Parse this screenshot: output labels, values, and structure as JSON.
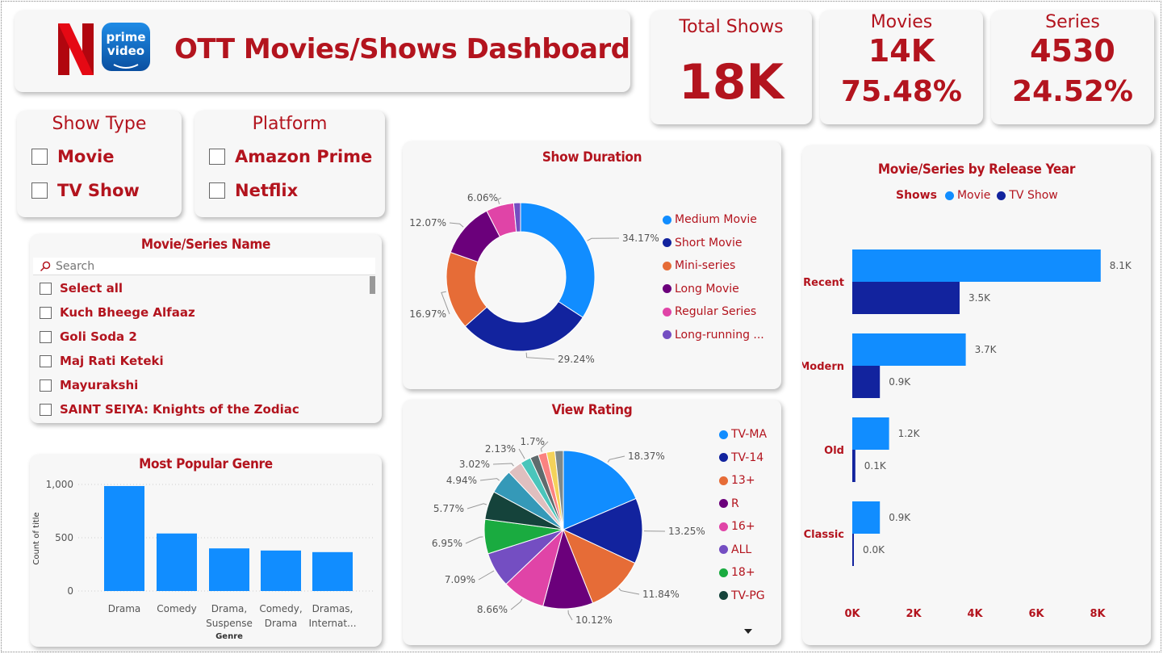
{
  "header": {
    "title": "OTT Movies/Shows Dashboard",
    "prime_logo_line1": "prime",
    "prime_logo_line2": "video"
  },
  "kpis": {
    "total": {
      "label": "Total Shows",
      "value": "18K"
    },
    "movies": {
      "label": "Movies",
      "value": "14K",
      "pct": "75.48%"
    },
    "series": {
      "label": "Series",
      "value": "4530",
      "pct": "24.52%"
    }
  },
  "show_type_slicer": {
    "title": "Show Type",
    "options": [
      "Movie",
      "TV Show"
    ]
  },
  "platform_slicer": {
    "title": "Platform",
    "options": [
      "Amazon Prime",
      "Netflix"
    ]
  },
  "name_slicer": {
    "title": "Movie/Series Name",
    "search_placeholder": "Search",
    "items": [
      "Select all",
      "Kuch Bheege Alfaaz",
      "Goli Soda 2",
      "Maj Rati Keteki",
      "Mayurakshi",
      "SAINT SEIYA: Knights of the Zodiac"
    ]
  },
  "colors": {
    "brand_red": "#b3141e",
    "movie": "#118dff",
    "tv_show": "#12239e"
  },
  "chart_data": [
    {
      "id": "show_duration",
      "type": "donut",
      "title": "Show Duration",
      "slices": [
        {
          "name": "Medium Movie",
          "value": 34.17,
          "label": "34.17%",
          "color": "#118dff"
        },
        {
          "name": "Short Movie",
          "value": 29.24,
          "label": "29.24%",
          "color": "#12239e"
        },
        {
          "name": "Mini-series",
          "value": 16.97,
          "label": "16.97%",
          "color": "#e66c37"
        },
        {
          "name": "Long Movie",
          "value": 12.07,
          "label": "12.07%",
          "color": "#6b007b"
        },
        {
          "name": "Regular Series",
          "value": 6.06,
          "label": "6.06%",
          "color": "#e044a7"
        },
        {
          "name": "Long-running ...",
          "value": 1.49,
          "label": "",
          "color": "#744ec2"
        }
      ]
    },
    {
      "id": "view_rating",
      "type": "pie",
      "title": "View Rating",
      "slices": [
        {
          "name": "TV-MA",
          "value": 18.37,
          "label": "18.37%",
          "color": "#118dff"
        },
        {
          "name": "TV-14",
          "value": 13.25,
          "label": "13.25%",
          "color": "#12239e"
        },
        {
          "name": "13+",
          "value": 11.84,
          "label": "11.84%",
          "color": "#e66c37"
        },
        {
          "name": "R",
          "value": 10.12,
          "label": "10.12%",
          "color": "#6b007b"
        },
        {
          "name": "16+",
          "value": 8.66,
          "label": "8.66%",
          "color": "#e044a7"
        },
        {
          "name": "ALL",
          "value": 7.09,
          "label": "7.09%",
          "color": "#744ec2"
        },
        {
          "name": "18+",
          "value": 6.95,
          "label": "6.95%",
          "color": "#1aab40"
        },
        {
          "name": "TV-PG",
          "value": 5.77,
          "label": "5.77%",
          "color": "#15433b"
        },
        {
          "name": "",
          "value": 4.94,
          "label": "4.94%",
          "color": "#3599b8"
        },
        {
          "name": "",
          "value": 3.02,
          "label": "3.02%",
          "color": "#dfbfbf"
        },
        {
          "name": "",
          "value": 2.13,
          "label": "2.13%",
          "color": "#4ac5bb"
        },
        {
          "name": "",
          "value": 1.7,
          "label": "",
          "color": "#5f6b6d"
        },
        {
          "name": "",
          "value": 1.7,
          "label": "1.7%",
          "color": "#fb8281"
        },
        {
          "name": "",
          "value": 1.7,
          "label": "",
          "color": "#f4d25a"
        },
        {
          "name": "",
          "value": 1.7,
          "label": "",
          "color": "#7f898a"
        }
      ]
    },
    {
      "id": "release_year",
      "type": "bar",
      "orientation": "horizontal",
      "title": "Movie/Series by Release Year",
      "legend_title": "Shows",
      "categories": [
        "Recent",
        "Modern",
        "Old",
        "Classic"
      ],
      "series": [
        {
          "name": "Movie",
          "values": [
            8.1,
            3.7,
            1.2,
            0.9
          ],
          "labels": [
            "8.1K",
            "3.7K",
            "1.2K",
            "0.9K"
          ]
        },
        {
          "name": "TV Show",
          "values": [
            3.5,
            0.9,
            0.1,
            0.0
          ],
          "labels": [
            "3.5K",
            "0.9K",
            "0.1K",
            "0.0K"
          ]
        }
      ],
      "xlim": [
        0,
        8.5
      ],
      "xticks": [
        "0K",
        "2K",
        "4K",
        "6K",
        "8K"
      ]
    },
    {
      "id": "popular_genre",
      "type": "bar",
      "title": "Most Popular Genre",
      "xlabel": "Genre",
      "ylabel": "Count of title",
      "categories": [
        [
          "Drama"
        ],
        [
          "Comedy"
        ],
        [
          "Drama,",
          "Suspense"
        ],
        [
          "Comedy,",
          "Drama"
        ],
        [
          "Dramas,",
          "Internat..."
        ]
      ],
      "values": [
        985,
        540,
        400,
        380,
        365
      ],
      "ylim": [
        0,
        1100
      ],
      "yticks": [
        "0",
        "500",
        "1,000"
      ],
      "grid": true
    }
  ]
}
